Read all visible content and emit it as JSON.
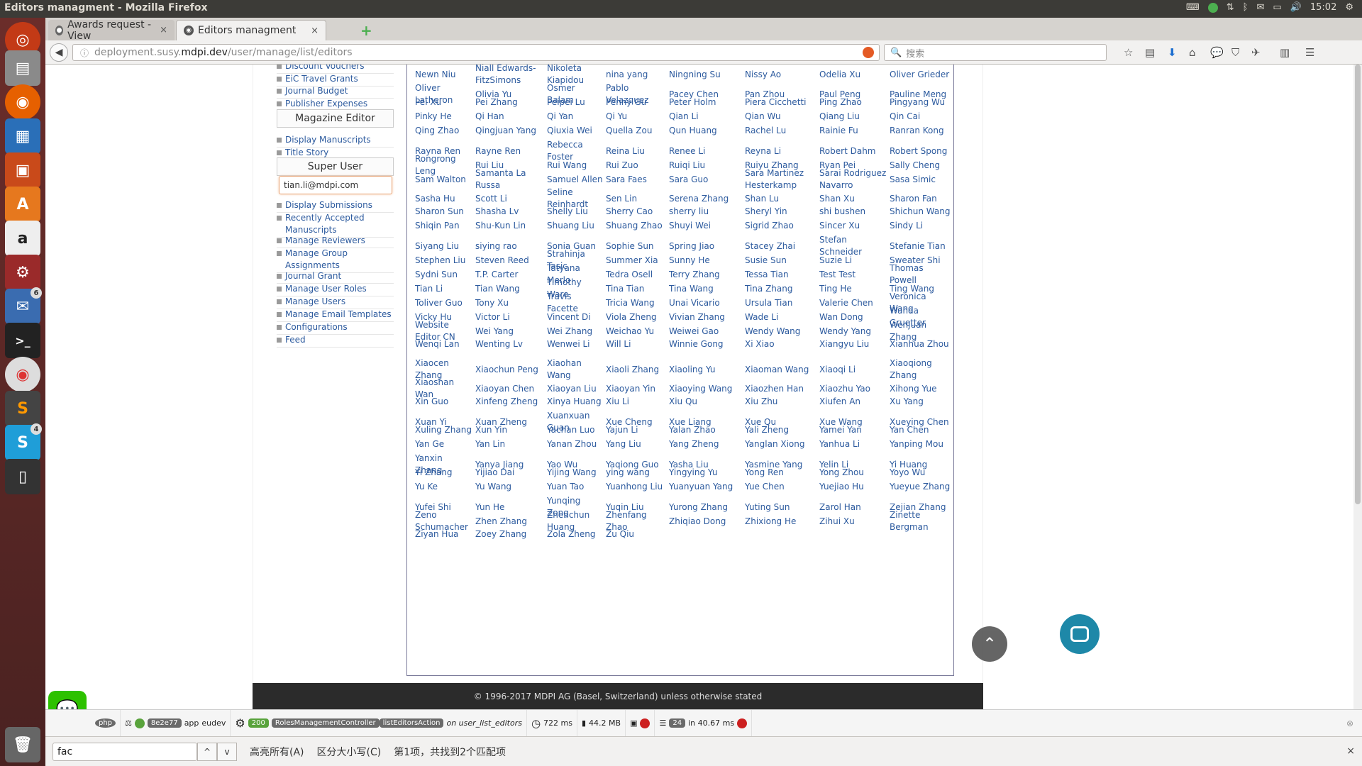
{
  "window": {
    "title": "Editors managment - Mozilla Firefox"
  },
  "topbar": {
    "time": "15:02"
  },
  "tabs": [
    {
      "label": "Awards request - View",
      "close": "×"
    },
    {
      "label": "Editors managment",
      "close": "×"
    }
  ],
  "newtab": "+",
  "url": {
    "prefix": "deployment.susy.",
    "domain": "mdpi.dev",
    "path": "/user/manage/list/editors"
  },
  "search": {
    "placeholder": "搜索"
  },
  "sidebar": {
    "links_top": [
      "Discount Vouchers",
      "EiC Travel Grants",
      "Journal Budget",
      "Publisher Expenses"
    ],
    "magazine_header": "Magazine Editor",
    "magazine_links": [
      "Display Manuscripts",
      "Title Story"
    ],
    "super_header": "Super User",
    "super_input_value": "tian.li@mdpi.com",
    "super_links": [
      "Display Submissions",
      "Recently Accepted Manuscripts",
      "Manage Reviewers",
      "Manage Group Assignments",
      "Journal Grant",
      "Manage User Roles",
      "Manage Users",
      "Manage Email Templates",
      "Configurations",
      "Feed"
    ]
  },
  "editors": [
    [
      "Newn Niu",
      "Niall Edwards-FitzSimons",
      "Nikoleta Kiapidou",
      "nina yang",
      "Ningning Su",
      "Nissy Ao",
      "Odelia Xu",
      "Oliver Grieder"
    ],
    [
      "Oliver Latheron",
      "Olivia Yu",
      "Osmer Balam",
      "Pablo Velazquez",
      "Pacey Chen",
      "Pan Zhou",
      "Paul Peng",
      "Pauline Meng"
    ],
    [
      "Pei Xu",
      "Pei Zhang",
      "Peipei Lu",
      "Penny Gu",
      "Peter Holm",
      "Piera Cicchetti",
      "Ping Zhao",
      "Pingyang Wu"
    ],
    [
      "Pinky He",
      "Qi Han",
      "Qi Yan",
      "Qi Yu",
      "Qian Li",
      "Qian Wu",
      "Qiang Liu",
      "Qin Cai"
    ],
    [
      "Qing Zhao",
      "Qingjuan Yang",
      "Qiuxia Wei",
      "Quella Zou",
      "Qun Huang",
      "Rachel Lu",
      "Rainie Fu",
      "Ranran Kong"
    ],
    [
      "Rayna Ren",
      "Rayne Ren",
      "Rebecca Foster",
      "Reina Liu",
      "Renee Li",
      "Reyna Li",
      "Robert Dahm",
      "Robert Spong"
    ],
    [
      "Rongrong Leng",
      "Rui Liu",
      "Rui Wang",
      "Rui Zuo",
      "Ruiqi Liu",
      "Ruiyu Zhang",
      "Ryan Pei",
      "Sally Cheng"
    ],
    [
      "Sam Walton",
      "Samanta La Russa",
      "Samuel Allen",
      "Sara Faes",
      "Sara Guo",
      "Sara Martinez Hesterkamp",
      "Sarai Rodriguez Navarro",
      "Sasa Simic"
    ],
    [
      "Sasha Hu",
      "Scott Li",
      "Seline Reinhardt",
      "Sen Lin",
      "Serena Zhang",
      "Shan Lu",
      "Shan Xu",
      "Sharon Fan"
    ],
    [
      "Sharon Sun",
      "Shasha Lv",
      "Shelly Liu",
      "Sherry Cao",
      "sherry liu",
      "Sheryl Yin",
      "shi bushen",
      "Shichun Wang"
    ],
    [
      "Shiqin Pan",
      "Shu-Kun Lin",
      "Shuang Liu",
      "Shuang Zhao",
      "Shuyi Wei",
      "Sigrid Zhao",
      "Sincer Xu",
      "Sindy Li"
    ],
    [
      "Siyang Liu",
      "siying rao",
      "Sonia Guan",
      "Sophie Sun",
      "Spring Jiao",
      "Stacey Zhai",
      "Stefan Schneider",
      "Stefanie Tian"
    ],
    [
      "Stephen Liu",
      "Steven Reed",
      "Strahinja Tasic",
      "Summer Xia",
      "Sunny He",
      "Susie Sun",
      "Suzie Li",
      "Sweater Shi"
    ],
    [
      "Sydni Sun",
      "T.P. Carter",
      "Tatyana Merlo",
      "Tedra Osell",
      "Terry Zhang",
      "Tessa Tian",
      "Test Test",
      "Thomas Powell"
    ],
    [
      "Tian Li",
      "Tian Wang",
      "Timothy Ware",
      "Tina Tian",
      "Tina Wang",
      "Tina Zhang",
      "Ting He",
      "Ting Wang"
    ],
    [
      "Toliver Guo",
      "Tony Xu",
      "Travis Facette",
      "Tricia Wang",
      "Unai Vicario",
      "Ursula Tian",
      "Valerie Chen",
      "Veronica Wang"
    ],
    [
      "Vicky Hu",
      "Victor Li",
      "Vincent Di",
      "Viola Zheng",
      "Vivian Zhang",
      "Wade Li",
      "Wan Dong",
      "Wanda Gruetter"
    ],
    [
      "Website Editor CN",
      "Wei Yang",
      "Wei Zhang",
      "Weichao Yu",
      "Weiwei Gao",
      "Wendy Wang",
      "Wendy Yang",
      "Wenjuan Zhang"
    ],
    [
      "Wenqi Lan",
      "Wenting Lv",
      "Wenwei Li",
      "Will Li",
      "Winnie Gong",
      "Xi Xiao",
      "Xiangyu Liu",
      "Xianhua Zhou"
    ],
    [
      "Xiaocen Zhang",
      "Xiaochun Peng",
      "Xiaohan Wang",
      "Xiaoli Zhang",
      "Xiaoling Yu",
      "Xiaoman Wang",
      "Xiaoqi Li",
      "Xiaoqiong Zhang"
    ],
    [
      "Xiaoshan Wan",
      "Xiaoyan Chen",
      "Xiaoyan Liu",
      "Xiaoyan Yin",
      "Xiaoying Wang",
      "Xiaozhen Han",
      "Xiaozhu Yao",
      "Xihong Yue"
    ],
    [
      "Xin Guo",
      "Xinfeng Zheng",
      "Xinya Huang",
      "Xiu Li",
      "Xiu Qu",
      "Xiu Zhu",
      "Xiufen An",
      "Xu Yang"
    ],
    [
      "Xuan Yi",
      "Xuan Zheng",
      "Xuanxuan Guan",
      "Xue Cheng",
      "Xue Liang",
      "Xue Qu",
      "Xue Wang",
      "Xueying Chen"
    ],
    [
      "Xuling Zhang",
      "Xun Yin",
      "Yachan Luo",
      "Yajun Li",
      "Yalan Zhao",
      "Yali Zheng",
      "Yamei Yan",
      "Yan Chen"
    ],
    [
      "Yan Ge",
      "Yan Lin",
      "Yanan Zhou",
      "Yang Liu",
      "Yang Zheng",
      "Yanglan Xiong",
      "Yanhua Li",
      "Yanping Mou"
    ],
    [
      "Yanxin Zhang",
      "Yanya Jiang",
      "Yao Wu",
      "Yaqiong Guo",
      "Yasha Liu",
      "Yasmine Yang",
      "Yelin Li",
      "Yi Huang"
    ],
    [
      "Yi Zhang",
      "Yijiao Dai",
      "Yijing Wang",
      "ying wang",
      "Yingying Yu",
      "Yong Ren",
      "Yong Zhou",
      "Yoyo Wu"
    ],
    [
      "Yu Ke",
      "Yu Wang",
      "Yuan Tao",
      "Yuanhong Liu",
      "Yuanyuan Yang",
      "Yue Chen",
      "Yuejiao Hu",
      "Yueyue Zhang"
    ],
    [
      "Yufei Shi",
      "Yun He",
      "Yunqing Zong",
      "Yuqin Liu",
      "Yurong Zhang",
      "Yuting Sun",
      "Zarol Han",
      "Zejian Zhang"
    ],
    [
      "Zeno Schumacher",
      "Zhen Zhang",
      "Zhenchun Huang",
      "Zhenfang Zhao",
      "Zhiqiao Dong",
      "Zhixiong He",
      "Zihui Xu",
      "Zinette Bergman"
    ],
    [
      "Ziyan Hua",
      "Zoey Zhang",
      "Zola Zheng",
      "Zu Qiu"
    ]
  ],
  "footer": "© 1996-2017 MDPI AG (Basel, Switzerland) unless otherwise stated",
  "debugbar": {
    "token": "8e2e77",
    "app": "app",
    "env": "eudev",
    "status": "200",
    "controller": "RolesManagementController",
    "action": "listEditorsAction",
    "route": "on user_list_editors",
    "time": "722 ms",
    "memory": "44.2 MB",
    "queries": "24",
    "query_time": "in 40.67 ms",
    "php": "php"
  },
  "findbar": {
    "value": "fac",
    "up": "^",
    "down": "v",
    "highlight_all": "高亮所有(A)",
    "match_case": "区分大小写(C)",
    "result": "第1项，共找到2个匹配项",
    "close": "×"
  },
  "launcher_badges": {
    "thunderbird": "6",
    "skype": "4"
  },
  "colors": {
    "link": "#2c5a9e",
    "launcher": "#5e2a2a",
    "footer": "#2b2b2b"
  }
}
